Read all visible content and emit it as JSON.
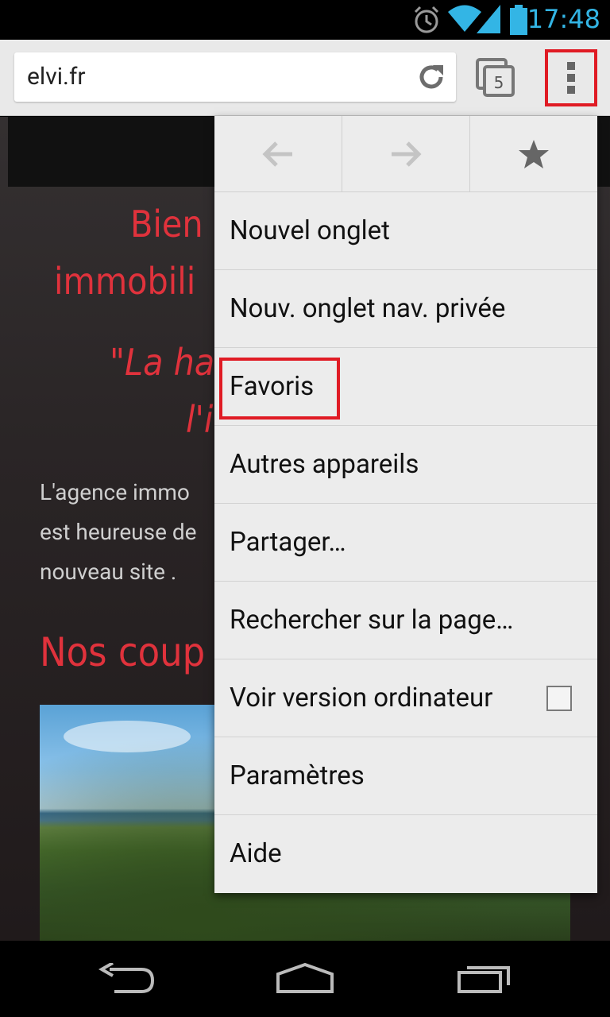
{
  "status_bar": {
    "time": "17:48",
    "icons": [
      "alarm-icon",
      "wifi-icon",
      "signal-icon",
      "battery-icon"
    ],
    "icon_color": "#33b5e5"
  },
  "toolbar": {
    "url": "elvi.fr",
    "tab_count": "5",
    "icons": [
      "reload-icon",
      "tabs-icon",
      "overflow-menu-icon"
    ]
  },
  "page": {
    "welcome_line1": "Bien",
    "welcome_line2": "immobili",
    "slogan_line1": "\"La ha",
    "slogan_line2": "l'i",
    "intro_line1": " L'agence immo",
    "intro_line2": "est heureuse de",
    "intro_line3": "nouveau site .",
    "section_title": "Nos coup",
    "accent_color": "#e0323c"
  },
  "menu": {
    "nav_icons": [
      "back-arrow-icon",
      "forward-arrow-icon",
      "bookmark-star-icon"
    ],
    "items": [
      {
        "label": "Nouvel onglet"
      },
      {
        "label": "Nouv. onglet nav. privée"
      },
      {
        "label": "Favoris"
      },
      {
        "label": "Autres appareils"
      },
      {
        "label": "Partager…"
      },
      {
        "label": "Rechercher sur la page…"
      },
      {
        "label": "Voir version ordinateur",
        "checkbox": false
      },
      {
        "label": "Paramètres"
      },
      {
        "label": "Aide"
      }
    ]
  },
  "annotations": {
    "highlight_color": "#e01b24",
    "highlighted": [
      "overflow-menu-button",
      "menu-item-favoris"
    ]
  },
  "navbar": {
    "icons": [
      "back-nav-icon",
      "home-nav-icon",
      "recent-apps-icon"
    ]
  }
}
